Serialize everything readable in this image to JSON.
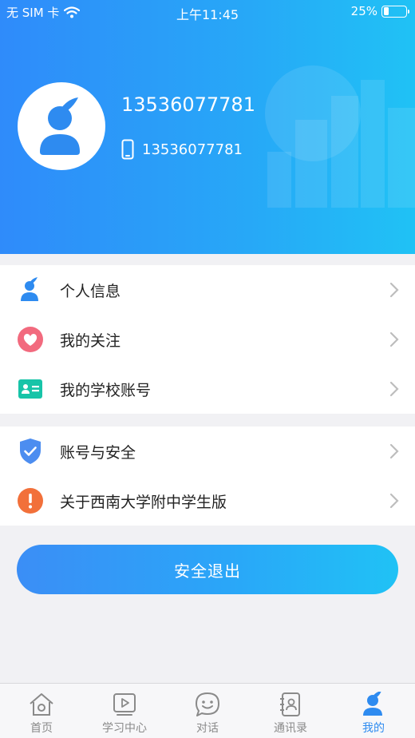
{
  "status_bar": {
    "carrier": "无 SIM 卡",
    "time": "上午11:45",
    "battery": "25%",
    "battery_level": 0.25
  },
  "profile": {
    "name": "13536077781",
    "phone": "13536077781"
  },
  "menu_group1": [
    {
      "key": "personal-info",
      "label": "个人信息",
      "icon": "person-icon"
    },
    {
      "key": "my-follows",
      "label": "我的关注",
      "icon": "heart-icon"
    },
    {
      "key": "school-account",
      "label": "我的学校账号",
      "icon": "id-card-icon"
    }
  ],
  "menu_group2": [
    {
      "key": "account-security",
      "label": "账号与安全",
      "icon": "shield-check-icon"
    },
    {
      "key": "about",
      "label": "关于西南大学附中学生版",
      "icon": "exclamation-icon"
    }
  ],
  "logout_label": "安全退出",
  "tabs": [
    {
      "key": "home",
      "label": "首页",
      "icon": "home-icon",
      "active": false
    },
    {
      "key": "study",
      "label": "学习中心",
      "icon": "play-icon",
      "active": false
    },
    {
      "key": "chat",
      "label": "对话",
      "icon": "smile-icon",
      "active": false
    },
    {
      "key": "contacts",
      "label": "通讯录",
      "icon": "contacts-icon",
      "active": false
    },
    {
      "key": "mine",
      "label": "我的",
      "icon": "person-icon",
      "active": true
    }
  ],
  "colors": {
    "accent": "#2E8BF0",
    "header_start": "#2F8BFA",
    "header_end": "#20C2F5",
    "tab_active": "#2E8BF0",
    "tab_inactive": "#8A8A8A",
    "heart": "#F26A7E",
    "id_card": "#17C4A8",
    "shield": "#4C8DF0",
    "exclamation": "#F2703A"
  }
}
